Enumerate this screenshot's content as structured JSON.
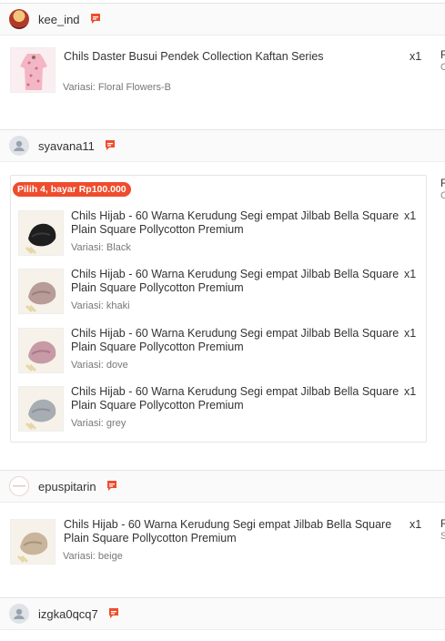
{
  "orders": [
    {
      "username": "kee_ind",
      "right_top": "R",
      "right_sub": "C",
      "items": [
        {
          "name": "Chils Daster Busui Pendek Collection Kaftan Series",
          "variant": "Variasi: Floral Flowers-B",
          "qty": "x1"
        }
      ]
    },
    {
      "username": "syavana11",
      "right_top": "R",
      "right_sub": "C",
      "bundle_badge": "Pilih 4, bayar Rp100.000",
      "items": [
        {
          "name": "Chils Hijab - 60 Warna Kerudung Segi empat Jilbab Bella Square Plain Square Pollycotton Premium",
          "variant": "Variasi: Black",
          "qty": "x1"
        },
        {
          "name": "Chils Hijab - 60 Warna Kerudung Segi empat Jilbab Bella Square Plain Square Pollycotton Premium",
          "variant": "Variasi: khaki",
          "qty": "x1"
        },
        {
          "name": "Chils Hijab - 60 Warna Kerudung Segi empat Jilbab Bella Square Plain Square Pollycotton Premium",
          "variant": "Variasi: dove",
          "qty": "x1"
        },
        {
          "name": "Chils Hijab - 60 Warna Kerudung Segi empat Jilbab Bella Square Plain Square Pollycotton Premium",
          "variant": "Variasi: grey",
          "qty": "x1"
        }
      ]
    },
    {
      "username": "epuspitarin",
      "right_top": "R",
      "right_sub": "S",
      "items": [
        {
          "name": "Chils Hijab - 60 Warna Kerudung Segi empat Jilbab Bella Square Plain Square Pollycotton Premium",
          "variant": "Variasi: beige",
          "qty": "x1"
        }
      ]
    },
    {
      "username": "izgka0qcq7"
    }
  ],
  "colors": {
    "accent": "#ee4d2d",
    "header_bg": "#fafafa",
    "border": "#e5e5e5"
  },
  "icons": {
    "chat": "chat-bubble-icon",
    "avatar_placeholder": "user-avatar-icon"
  }
}
